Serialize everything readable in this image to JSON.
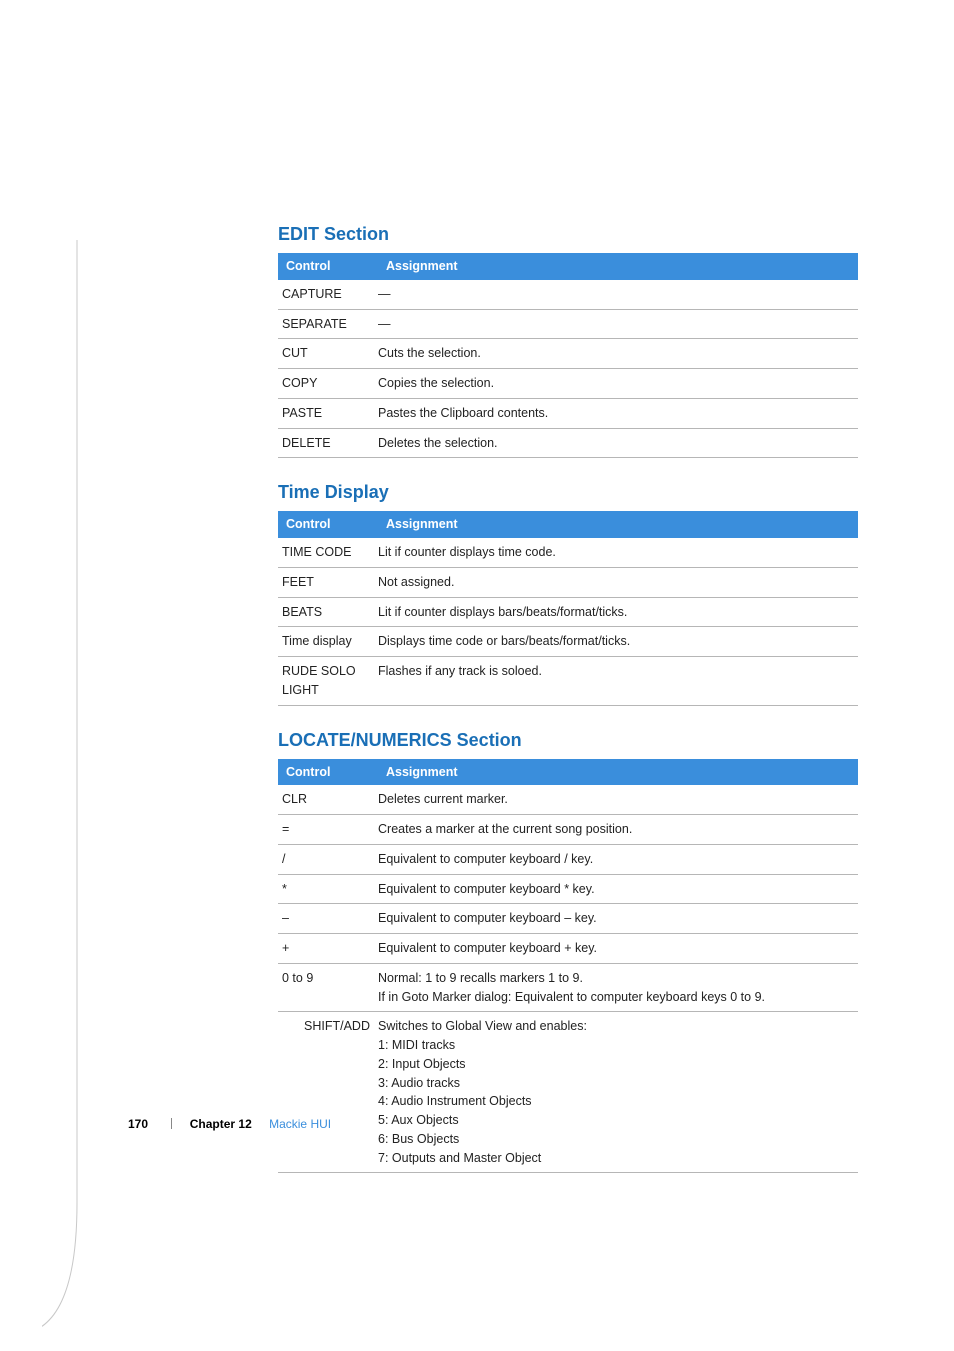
{
  "sections": [
    {
      "heading": "EDIT Section",
      "header": {
        "control": "Control",
        "assignment": "Assignment"
      },
      "rows": [
        {
          "control": "CAPTURE",
          "assignment": "—"
        },
        {
          "control": "SEPARATE",
          "assignment": "—"
        },
        {
          "control": "CUT",
          "assignment": "Cuts the selection."
        },
        {
          "control": "COPY",
          "assignment": "Copies the selection."
        },
        {
          "control": "PASTE",
          "assignment": "Pastes the Clipboard contents."
        },
        {
          "control": "DELETE",
          "assignment": "Deletes the selection."
        }
      ]
    },
    {
      "heading": "Time Display",
      "header": {
        "control": "Control",
        "assignment": "Assignment"
      },
      "rows": [
        {
          "control": "TIME CODE",
          "assignment": "Lit if counter displays time code."
        },
        {
          "control": "FEET",
          "assignment": "Not assigned."
        },
        {
          "control": "BEATS",
          "assignment": "Lit if counter displays bars/beats/format/ticks."
        },
        {
          "control": "Time display",
          "assignment": "Displays time code or bars/beats/format/ticks."
        },
        {
          "control": "RUDE SOLO LIGHT",
          "assignment": "Flashes if any track is soloed."
        }
      ]
    },
    {
      "heading": "LOCATE/NUMERICS Section",
      "header": {
        "control": "Control",
        "assignment": "Assignment"
      },
      "rows": [
        {
          "control": "CLR",
          "assignment": "Deletes current marker."
        },
        {
          "control": "=",
          "assignment": "Creates a marker at the current song position."
        },
        {
          "control": "/",
          "assignment": "Equivalent to computer keyboard / key."
        },
        {
          "control": "*",
          "assignment": "Equivalent to computer keyboard * key."
        },
        {
          "control": "–",
          "assignment": "Equivalent to computer keyboard – key."
        },
        {
          "control": "+",
          "assignment": "Equivalent to computer keyboard + key."
        },
        {
          "control": "0 to 9",
          "assignment_lines": [
            "Normal:  1 to 9 recalls markers 1 to 9.",
            "If in Goto Marker dialog:  Equivalent to computer keyboard keys 0 to 9."
          ]
        },
        {
          "control": "SHIFT/ADD",
          "control_align": "right",
          "assignment_lines": [
            "Switches to Global View and enables:",
            "1:  MIDI tracks",
            "2:  Input Objects",
            "3:  Audio tracks",
            "4:  Audio Instrument Objects",
            "5:  Aux Objects",
            "6:  Bus Objects",
            "7:  Outputs and Master Object"
          ]
        }
      ]
    }
  ],
  "footer": {
    "page_number": "170",
    "chapter": "Chapter 12",
    "chapter_title": "Mackie HUI"
  }
}
